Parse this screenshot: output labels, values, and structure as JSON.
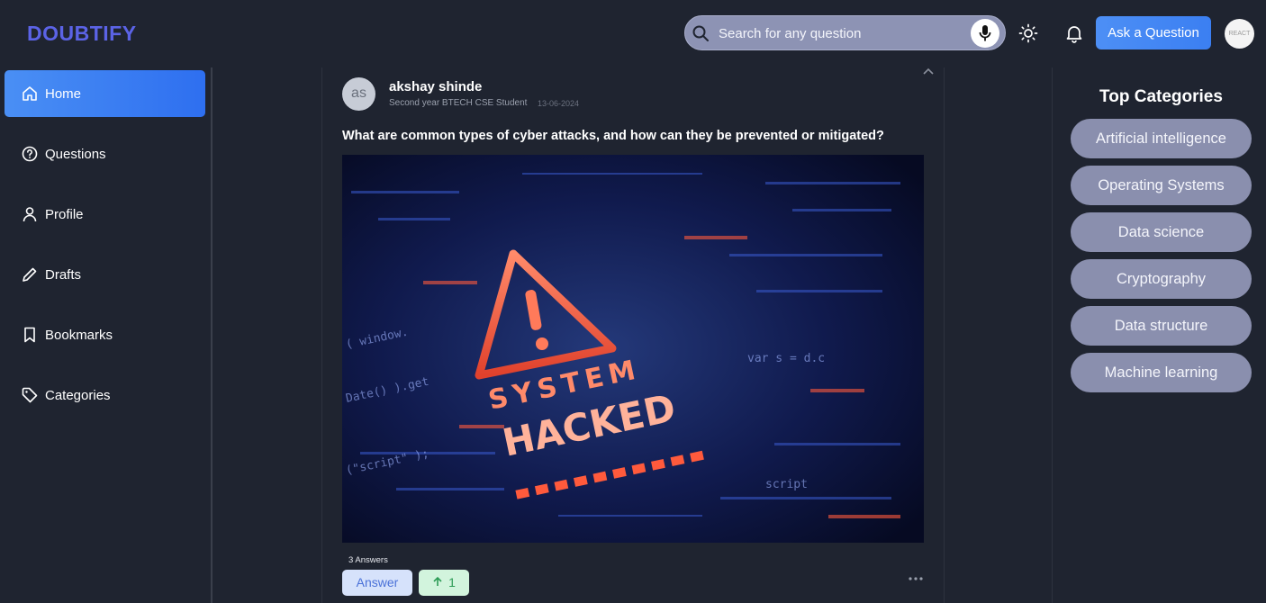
{
  "header": {
    "logo": "DOUBTIFY",
    "search_placeholder": "Search for any question",
    "ask_button": "Ask a Question",
    "avatar_text": "REACT"
  },
  "sidebar": {
    "items": [
      {
        "label": "Home",
        "icon": "home-icon",
        "active": true
      },
      {
        "label": "Questions",
        "icon": "question-circle-icon",
        "active": false
      },
      {
        "label": "Profile",
        "icon": "user-icon",
        "active": false
      },
      {
        "label": "Drafts",
        "icon": "pencil-icon",
        "active": false
      },
      {
        "label": "Bookmarks",
        "icon": "bookmark-icon",
        "active": false
      },
      {
        "label": "Categories",
        "icon": "tag-icon",
        "active": false
      }
    ]
  },
  "post": {
    "avatar_initials": "as",
    "author": "akshay shinde",
    "role": "Second year BTECH CSE Student",
    "date": "13-06-2024",
    "question": "What are common types of cyber attacks, and how can they be prevented or mitigated?",
    "image_text_line1": "SYSTEM",
    "image_text_line2": "HACKED",
    "answers_count": "3 Answers",
    "answer_button": "Answer",
    "upvote_count": "1"
  },
  "categories": {
    "title": "Top Categories",
    "items": [
      "Artificial intelligence",
      "Operating Systems",
      "Data science",
      "Cryptography",
      "Data structure",
      "Machine learning"
    ]
  },
  "colors": {
    "background": "#1f2430",
    "logo": "#5b63e6",
    "accent_blue": "#3b7ff2",
    "category_pill": "#8a8fae"
  }
}
